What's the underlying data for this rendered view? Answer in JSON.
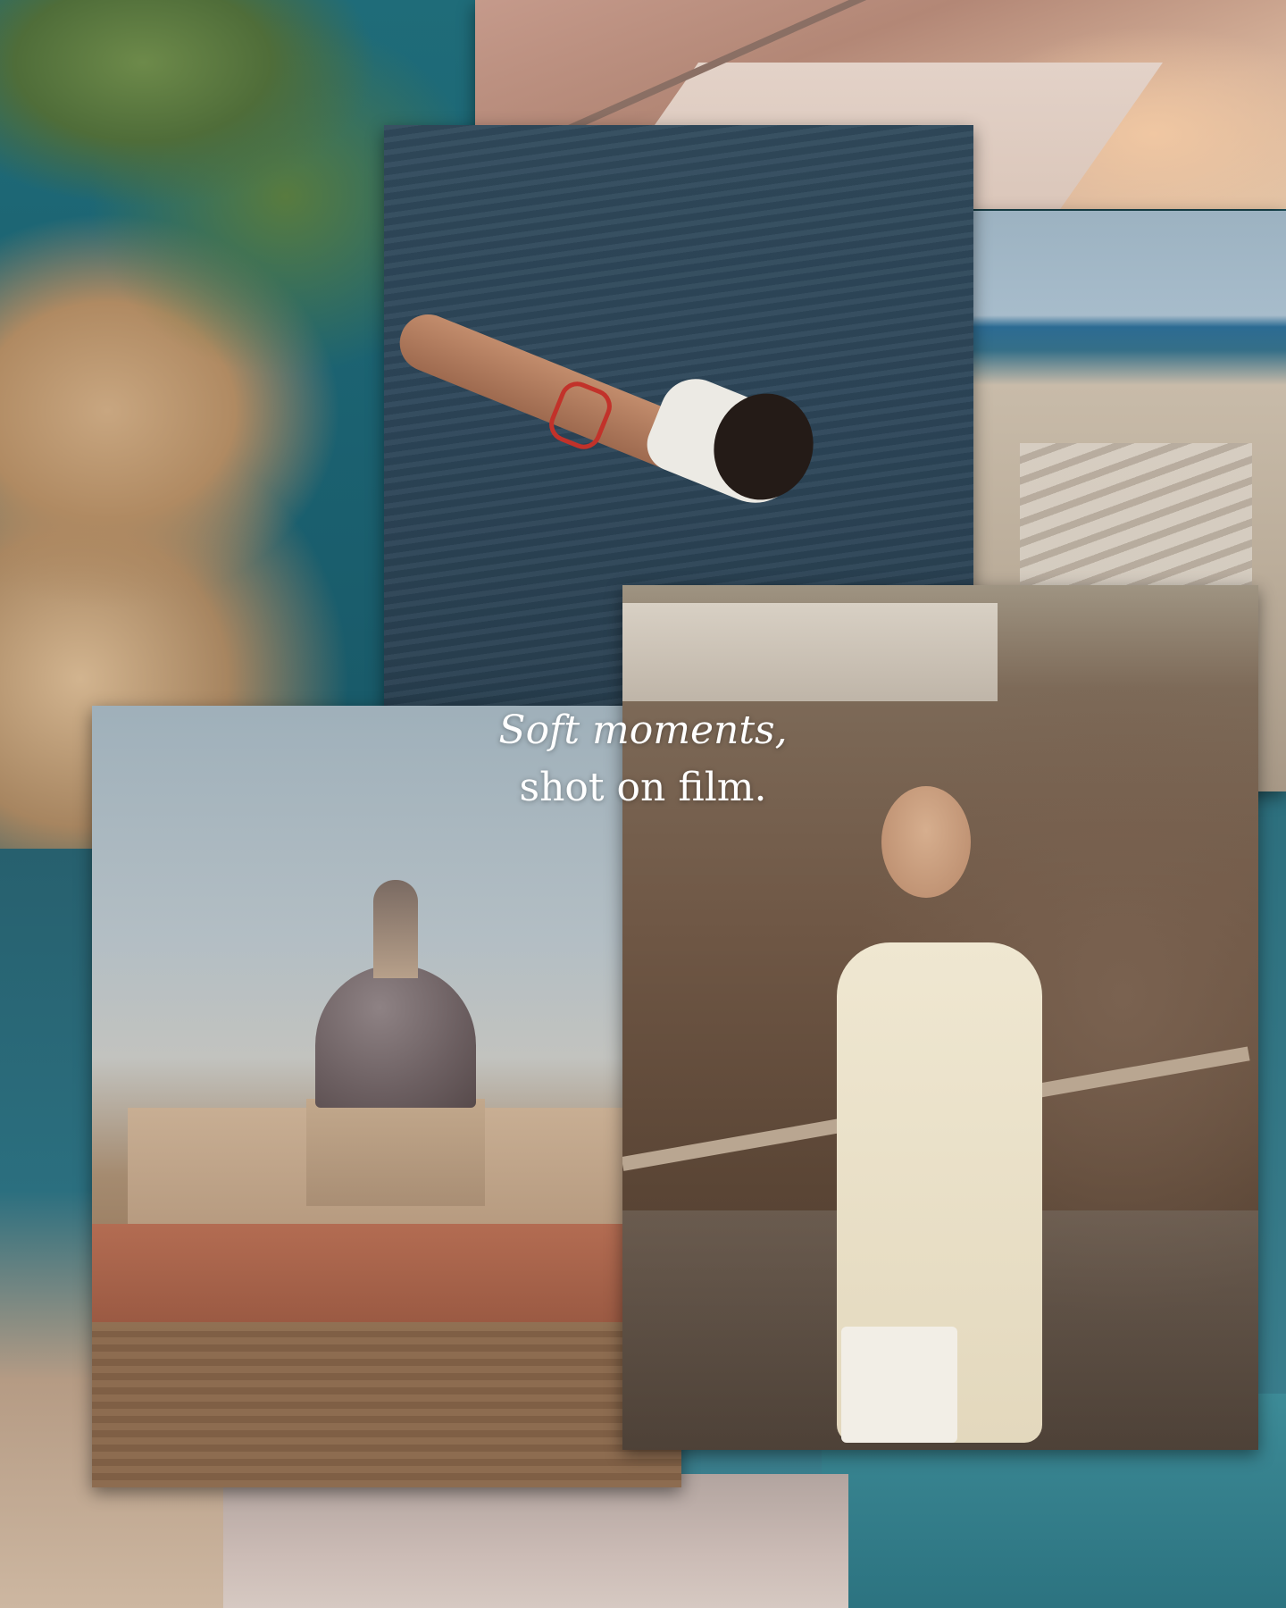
{
  "headline": {
    "line1": "Soft moments,",
    "line2": "shot on film."
  },
  "colors": {
    "text": "#ffffff",
    "sea": "#1f6c79",
    "film_warm": "#b38776"
  }
}
